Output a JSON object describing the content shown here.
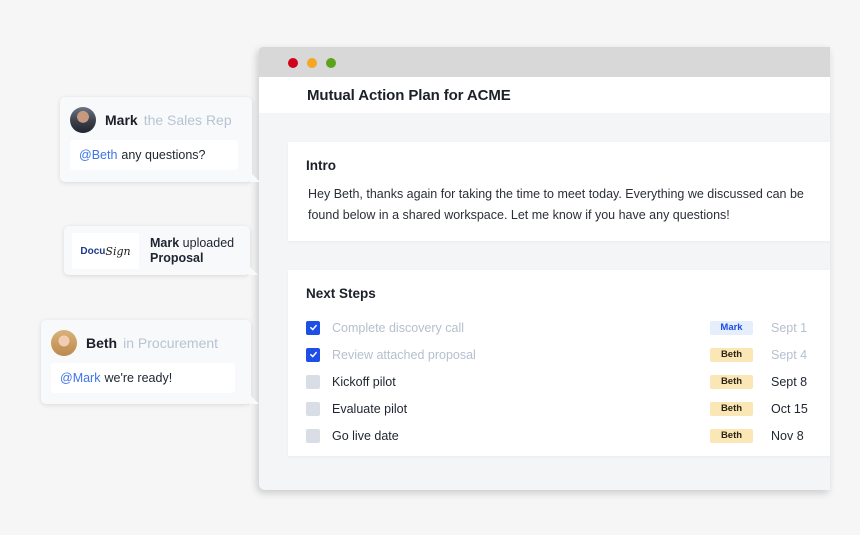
{
  "window": {
    "controls": [
      "close",
      "minimize",
      "maximize"
    ],
    "title": "Mutual Action Plan for ACME"
  },
  "intro": {
    "heading": "Intro",
    "text": "Hey Beth, thanks again for taking the time to meet today. Everything we discussed can be found below in a shared workspace. Let me know if you have any questions!"
  },
  "next_steps": {
    "heading": "Next Steps",
    "items": [
      {
        "label": "Complete discovery call",
        "checked": true,
        "owner": "Mark",
        "date": "Sept 1"
      },
      {
        "label": "Review attached proposal",
        "checked": true,
        "owner": "Beth",
        "date": "Sept 4"
      },
      {
        "label": "Kickoff pilot",
        "checked": false,
        "owner": "Beth",
        "date": "Sept 8"
      },
      {
        "label": "Evaluate pilot",
        "checked": false,
        "owner": "Beth",
        "date": "Oct 15"
      },
      {
        "label": "Go live date",
        "checked": false,
        "owner": "Beth",
        "date": "Nov 8"
      }
    ]
  },
  "bubbles": {
    "mark": {
      "name": "Mark",
      "role": "the Sales Rep",
      "mention": "@Beth",
      "message": "any questions?"
    },
    "docusign": {
      "logo_part1": "Docu",
      "logo_part2": "Sign",
      "actor": "Mark",
      "action": "uploaded",
      "object": "Proposal"
    },
    "beth": {
      "name": "Beth",
      "role": "in Procurement",
      "mention": "@Mark",
      "message": "we're ready!"
    }
  },
  "colors": {
    "accent_blue": "#1d4ee6",
    "mention_blue": "#3d74e8",
    "beth_badge": "#fbe7b5",
    "mark_badge": "#e6edfb"
  }
}
